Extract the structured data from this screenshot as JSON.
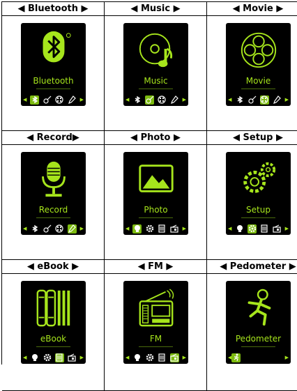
{
  "headers": [
    "◀ Bluetooth ▶",
    "◀ Music ▶",
    "◀ Movie ▶",
    "◀ Record▶",
    "◀ Photo ▶",
    "◀ Setup ▶",
    "◀ eBook ▶",
    "◀ FM ▶",
    "◀ Pedometer ▶"
  ],
  "screens": [
    {
      "label": "Bluetooth",
      "icon": "bluetooth-icon",
      "mini": [
        "bluetooth",
        "guitar",
        "film",
        "mic"
      ],
      "active": 0
    },
    {
      "label": "Music",
      "icon": "music-icon",
      "mini": [
        "bluetooth",
        "guitar",
        "film",
        "mic"
      ],
      "active": 1
    },
    {
      "label": "Movie",
      "icon": "movie-icon",
      "mini": [
        "bluetooth",
        "guitar",
        "film",
        "mic"
      ],
      "active": 2
    },
    {
      "label": "Record",
      "icon": "microphone-icon",
      "mini": [
        "bluetooth",
        "guitar",
        "film",
        "mic"
      ],
      "active": 3
    },
    {
      "label": "Photo",
      "icon": "photo-icon",
      "mini": [
        "photo",
        "gear",
        "book",
        "radio"
      ],
      "active": 0
    },
    {
      "label": "Setup",
      "icon": "gears-icon",
      "mini": [
        "photo",
        "gear",
        "book",
        "radio"
      ],
      "active": 1
    },
    {
      "label": "eBook",
      "icon": "books-icon",
      "mini": [
        "photo",
        "gear",
        "book",
        "radio"
      ],
      "active": 2
    },
    {
      "label": "FM",
      "icon": "radio-icon",
      "mini": [
        "photo",
        "gear",
        "book",
        "radio"
      ],
      "active": 3
    },
    {
      "label": "Pedometer",
      "icon": "runner-icon",
      "mini": [
        "runner"
      ],
      "active": 0
    }
  ],
  "colors": {
    "accent": "#a6e51c",
    "active_bg": "#7dbb10",
    "screen": "#000000"
  }
}
